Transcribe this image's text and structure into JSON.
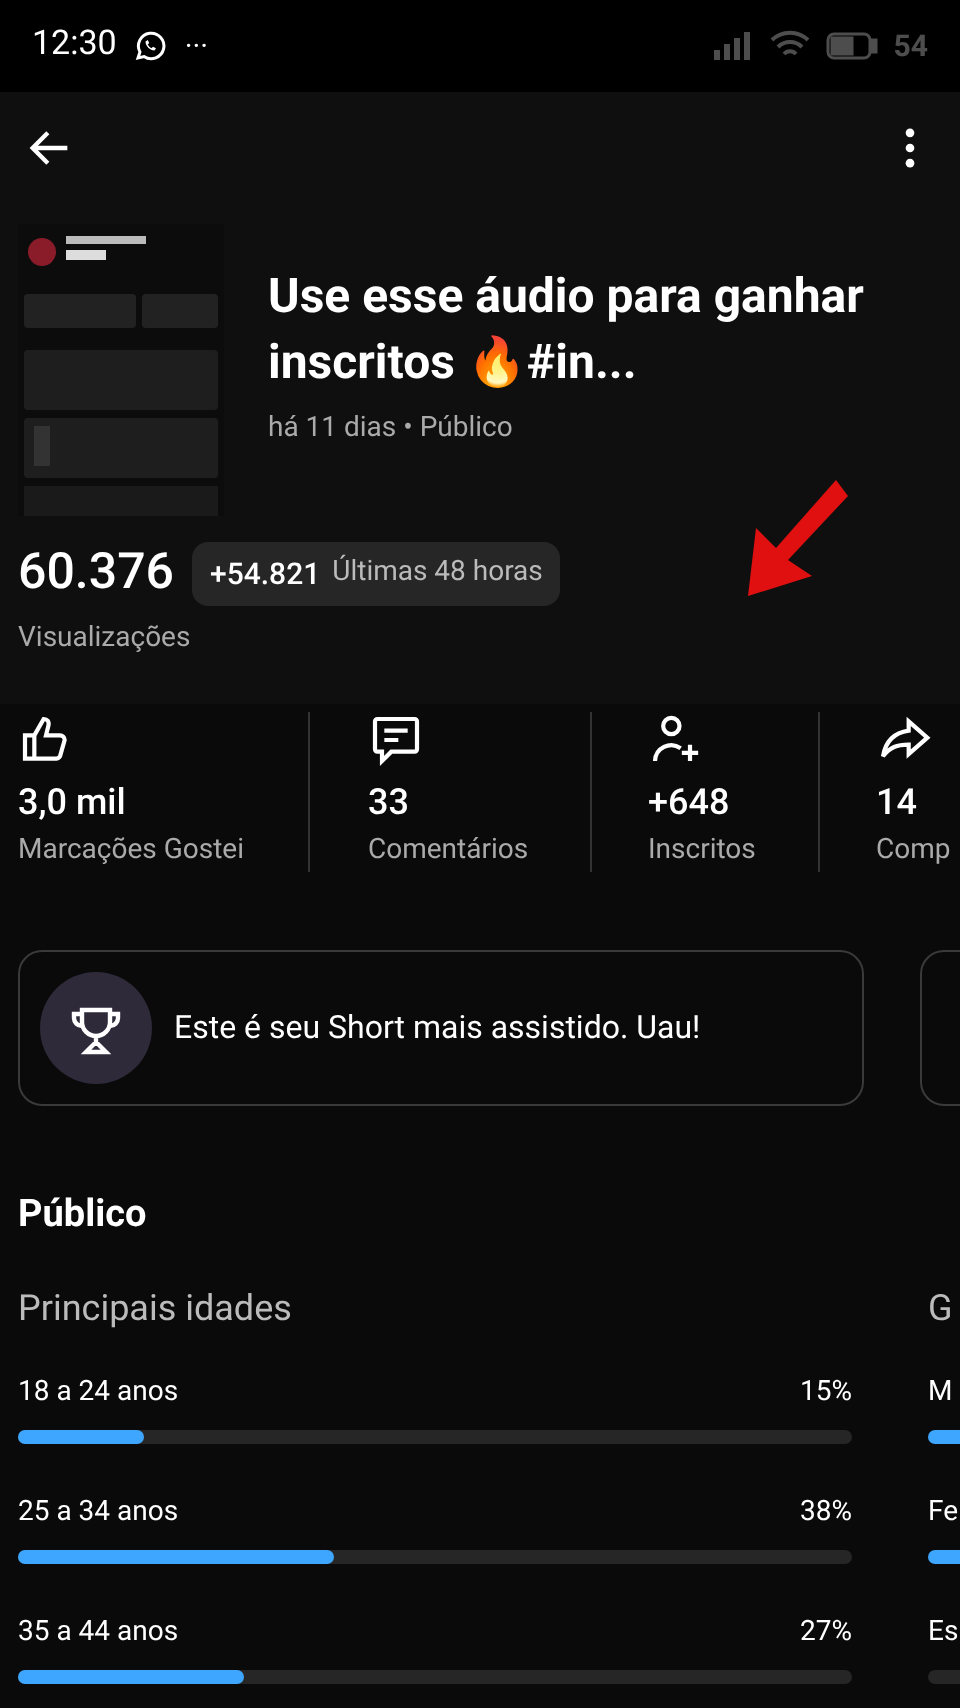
{
  "status_bar": {
    "time": "12:30",
    "more": "···",
    "battery": "54"
  },
  "video": {
    "title": "Use esse áudio para ganhar inscritos 🔥#in...",
    "meta": "há 11 dias • Público"
  },
  "views": {
    "value": "60.376",
    "label": "Visualizações",
    "recent": {
      "delta": "+54.821",
      "period": "Últimas 48 horas"
    }
  },
  "stats": [
    {
      "kind": "like",
      "value": "3,0 mil",
      "label": "Marcações Gostei"
    },
    {
      "kind": "comment",
      "value": "33",
      "label": "Comentários"
    },
    {
      "kind": "subscribe",
      "value": "+648",
      "label": "Inscritos"
    },
    {
      "kind": "share",
      "value": "14",
      "label": "Comp"
    }
  ],
  "achievement": {
    "text": "Este é seu Short mais assistido. Uau!"
  },
  "audience": {
    "title": "Público",
    "ages": {
      "title": "Principais idades",
      "items": [
        {
          "label": "18 a 24 anos",
          "percent": "15%",
          "level": 0.15
        },
        {
          "label": "25 a 34 anos",
          "percent": "38%",
          "level": 0.38
        },
        {
          "label": "35 a 44 anos",
          "percent": "27%",
          "level": 0.27
        }
      ]
    },
    "gender": {
      "title": "G",
      "items": [
        {
          "label": "M",
          "color": "#3ea6ff"
        },
        {
          "label": "Fe",
          "color": "#3ea6ff"
        },
        {
          "label": "Es",
          "color": "#262626"
        }
      ]
    }
  }
}
